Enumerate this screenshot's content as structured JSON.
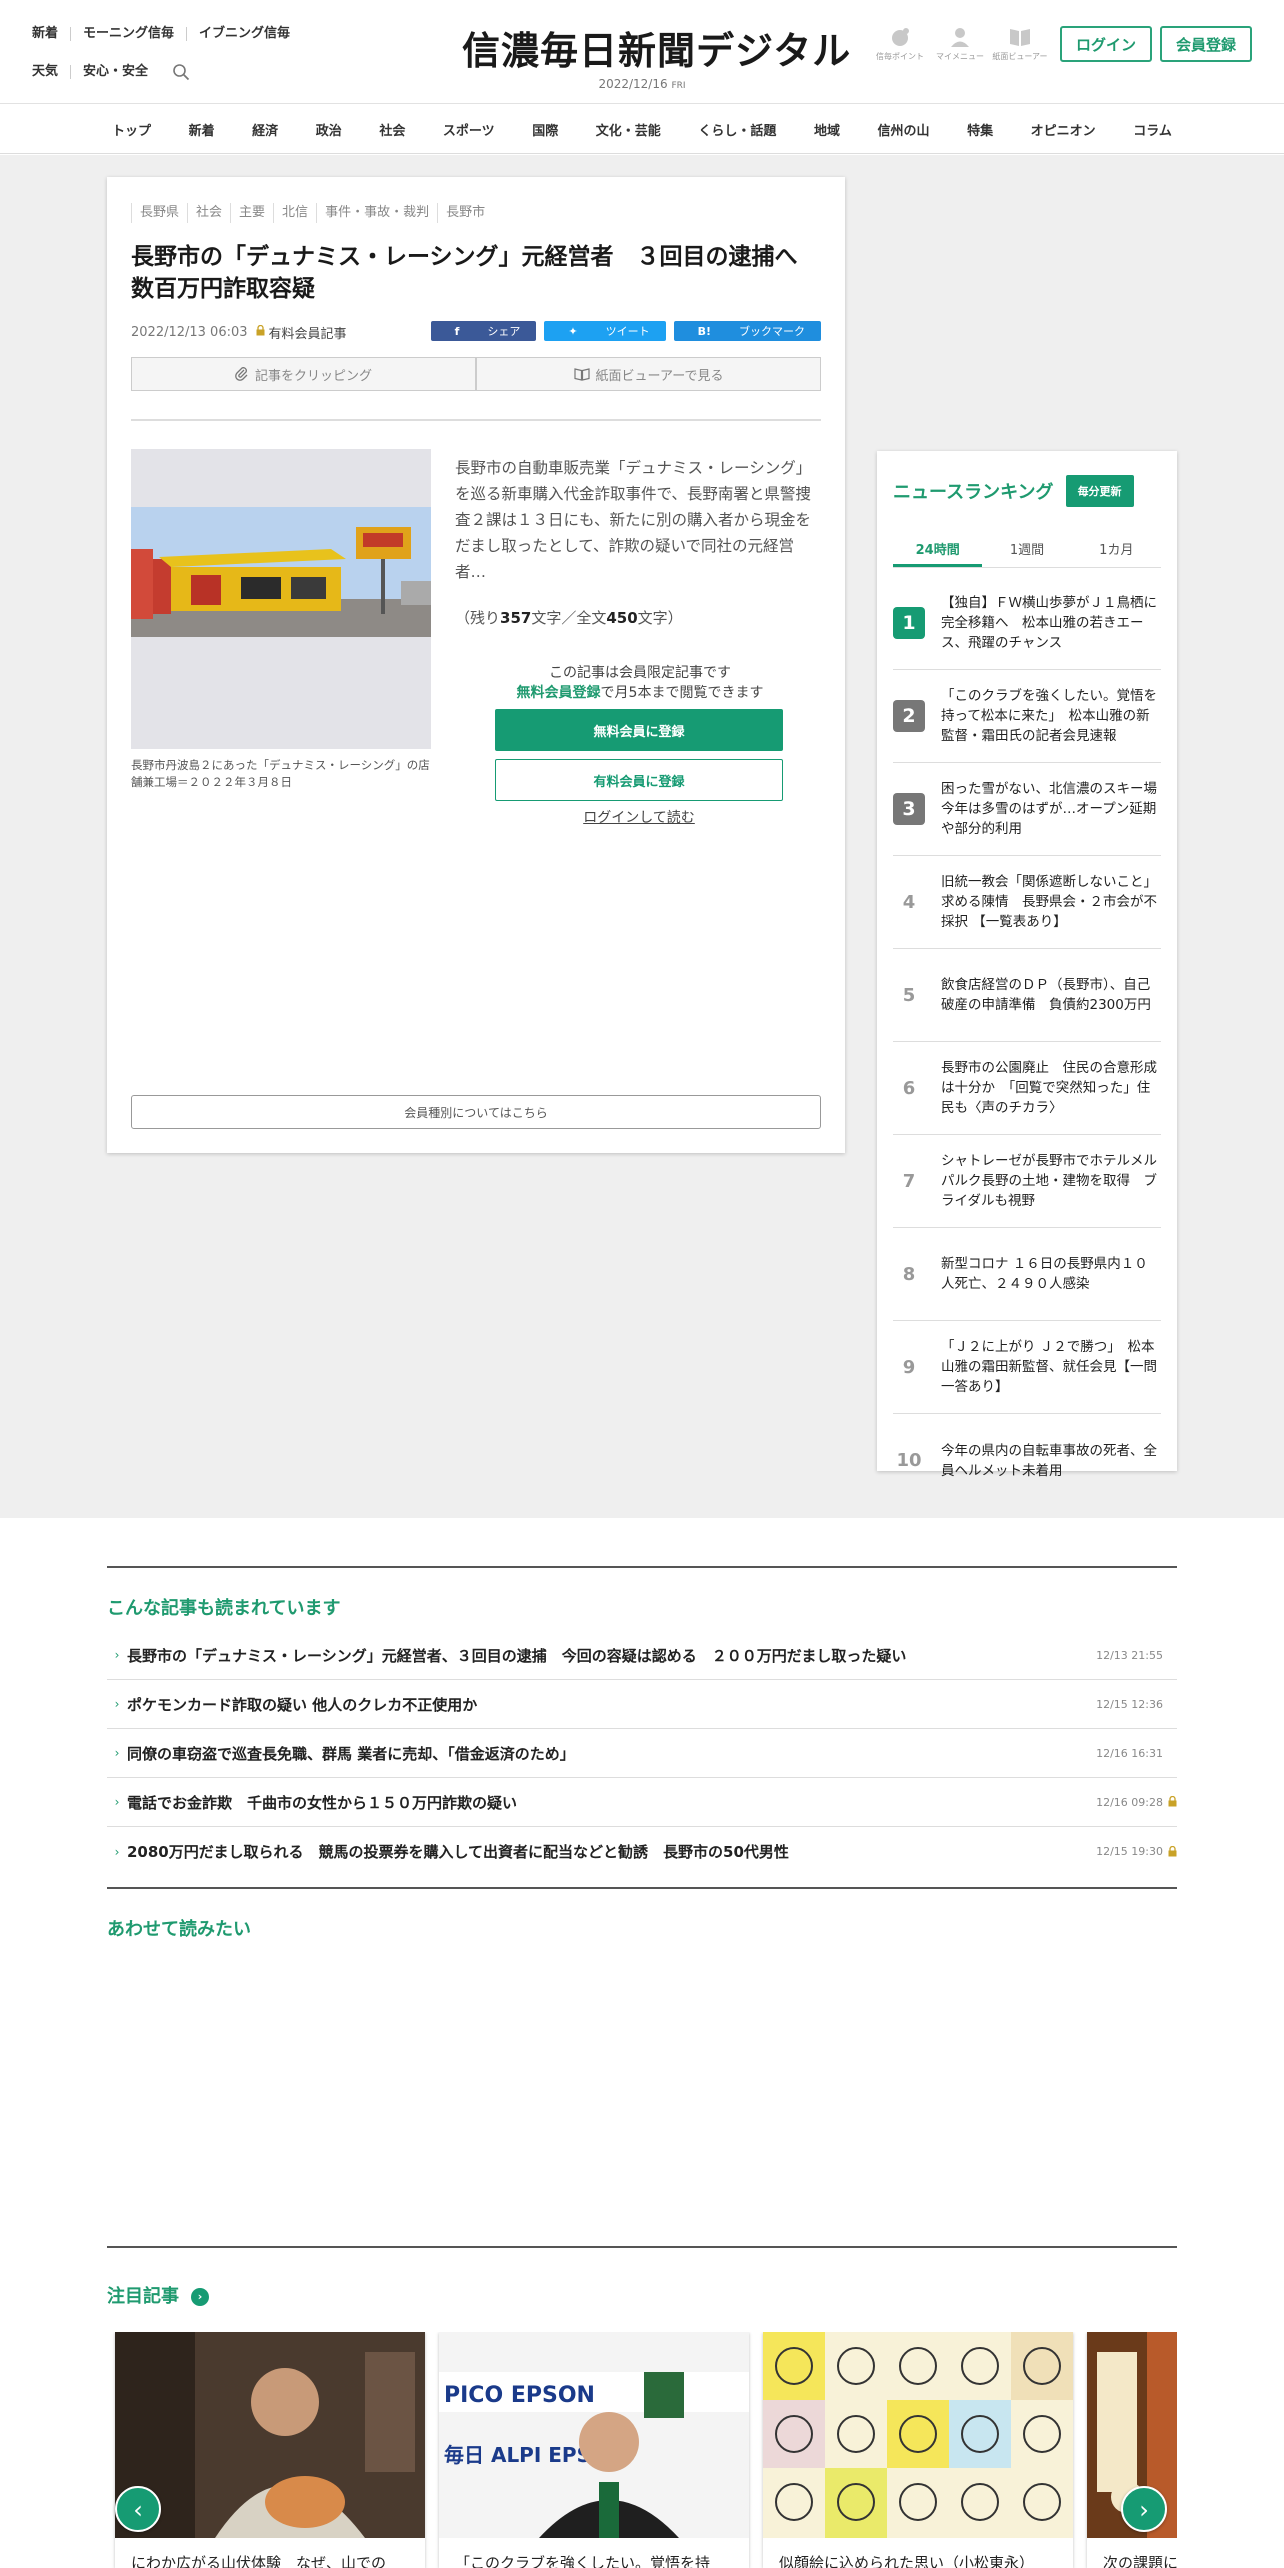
{
  "header": {
    "links_row1": [
      "新着",
      "モーニング信毎",
      "イブニング信毎"
    ],
    "links_row2": [
      "天気",
      "安心・安全"
    ],
    "logo": "信濃毎日新聞デジタル",
    "date": "2022/12/16",
    "weekday": "FRI",
    "icons": [
      {
        "label": "信毎ポイント",
        "icon": "point-icon"
      },
      {
        "label": "マイメニュー",
        "icon": "user-icon"
      },
      {
        "label": "紙面ビューアー",
        "icon": "book-icon"
      }
    ],
    "login": "ログイン",
    "register": "会員登録",
    "accent": "#169b73"
  },
  "nav": [
    "トップ",
    "新着",
    "経済",
    "政治",
    "社会",
    "スポーツ",
    "国際",
    "文化・芸能",
    "くらし・話題",
    "地域",
    "信州の山",
    "特集",
    "オピニオン",
    "コラム"
  ],
  "article": {
    "tags": [
      "長野県",
      "社会",
      "主要",
      "北信",
      "事件・事故・裁判",
      "長野市"
    ],
    "title": "長野市の「デュナミス・レーシング」元経営者　３回目の逮捕へ　数百万円詐取容疑",
    "datetime": "2022/12/13 06:03",
    "paid_label": "有料会員記事",
    "share": {
      "facebook": "シェア",
      "twitter": "ツイート",
      "hatena": "ブックマーク"
    },
    "clip": "記事をクリッピング",
    "viewer": "紙面ビューアーで見る",
    "caption": "長野市丹波島２にあった「デュナミス・レーシング」の店舗兼工場＝２０２２年３月８日",
    "lead": "長野市の自動車販売業「デュナミス・レーシング」を巡る新車購入代金詐取事件で、長野南署と県警捜査２課は１３日にも、新たに別の購入者から現金をだまし取ったとして、詐欺の疑いで同社の元経営者…",
    "remain_prefix": "（残り",
    "remain_count": "357",
    "remain_mid": "文字／全文",
    "total_count": "450",
    "remain_suffix": "文字）",
    "limited_line1": "この記事は会員限定記事です",
    "limited_link": "無料会員登録",
    "limited_line2_rest": "で月5本まで閲覧できます",
    "btn_free": "無料会員に登録",
    "btn_paid": "有料会員に登録",
    "login_read": "ログインして読む",
    "member_types": "会員種別についてはこちら"
  },
  "ranking": {
    "title": "ニュースランキング",
    "update": "毎分更新",
    "tabs": [
      "24時間",
      "1週間",
      "1カ月"
    ],
    "active_tab": 0,
    "items": [
      {
        "rank": "1",
        "text": "【独自】ＦＷ横山歩夢がＪ１鳥栖に完全移籍へ　松本山雅の若きエース、飛躍のチャンス"
      },
      {
        "rank": "2",
        "text": "「このクラブを強くしたい。覚悟を持って松本に来た」　松本山雅の新監督・霜田氏の記者会見速報"
      },
      {
        "rank": "3",
        "text": "困った雪がない、北信濃のスキー場　今年は多雪のはずが…オープン延期や部分的利用"
      },
      {
        "rank": "4",
        "text": "旧統一教会「関係遮断しないこと」求める陳情　長野県会・２市会が不採択 【一覧表あり】"
      },
      {
        "rank": "5",
        "text": "飲食店経営のＤＰ（長野市）、自己破産の申請準備　負債約2300万円"
      },
      {
        "rank": "6",
        "text": "長野市の公園廃止　住民の合意形成は十分か　「回覧で突然知った」住民も〈声のチカラ〉"
      },
      {
        "rank": "7",
        "text": "シャトレーゼが長野市でホテルメルパルク長野の土地・建物を取得　ブライダルも視野"
      },
      {
        "rank": "8",
        "text": "新型コロナ １６日の長野県内１０人死亡、２４９０人感染"
      },
      {
        "rank": "9",
        "text": "「Ｊ２に上がり Ｊ２で勝つ」　松本山雅の霜田新監督、就任会見【一問一答あり】"
      },
      {
        "rank": "10",
        "text": "今年の県内の自転車事故の死者、全員ヘルメット未着用"
      }
    ]
  },
  "related": {
    "title": "こんな記事も読まれています",
    "items": [
      {
        "title": "長野市の「デュナミス・レーシング」元経営者、３回目の逮捕　今回の容疑は認める　２００万円だまし取った疑い",
        "time": "12/13 21:55",
        "locked": false
      },
      {
        "title": "ポケモンカード詐取の疑い 他人のクレカ不正使用か",
        "time": "12/15 12:36",
        "locked": false
      },
      {
        "title": "同僚の車窃盗で巡査長免職、群馬 業者に売却、「借金返済のため」",
        "time": "12/16 16:31",
        "locked": false
      },
      {
        "title": "電話でお金詐欺　千曲市の女性から１５０万円詐欺の疑い",
        "time": "12/16 09:28",
        "locked": true
      },
      {
        "title": "2080万円だまし取られる　競馬の投票券を購入して出資者に配当などと勧誘　長野市の50代男性",
        "time": "12/15 19:30",
        "locked": true
      }
    ]
  },
  "also_read": {
    "title": "あわせて読みたい"
  },
  "attention": {
    "title": "注目記事",
    "cards": [
      {
        "title": "にわか広がる山伏体験　なぜ、山での"
      },
      {
        "title": "「このクラブを強くしたい。覚悟を持"
      },
      {
        "title": "似顔絵に込められた思い（小松東永）"
      },
      {
        "title": "次の課題に"
      }
    ]
  }
}
